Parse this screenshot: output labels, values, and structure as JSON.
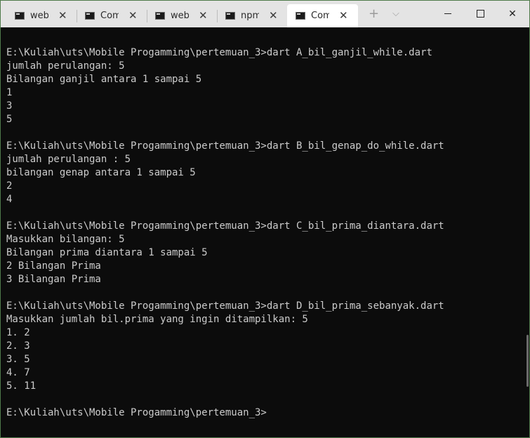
{
  "tabs": [
    {
      "label": "webp",
      "close": "✕",
      "active": false
    },
    {
      "label": "Com",
      "close": "✕",
      "active": false
    },
    {
      "label": "webp",
      "close": "✕",
      "active": false
    },
    {
      "label": "npm",
      "close": "✕",
      "active": false
    },
    {
      "label": "Com",
      "close": "✕",
      "active": true
    }
  ],
  "titlebar": {
    "new_tab_icon": "plus-icon",
    "new_tab_glyph": "+",
    "dropdown_icon": "chevron-down-icon",
    "dropdown_glyph": "⌵",
    "close_glyph": "✕"
  },
  "terminal": {
    "lines": [
      "E:\\Kuliah\\uts\\Mobile Progamming\\pertemuan_3>dart A_bil_ganjil_while.dart",
      "jumlah perulangan: 5",
      "Bilangan ganjil antara 1 sampai 5",
      "1",
      "3",
      "5",
      "",
      "E:\\Kuliah\\uts\\Mobile Progamming\\pertemuan_3>dart B_bil_genap_do_while.dart",
      "jumlah perulangan : 5",
      "bilangan genap antara 1 sampai 5",
      "2",
      "4",
      "",
      "E:\\Kuliah\\uts\\Mobile Progamming\\pertemuan_3>dart C_bil_prima_diantara.dart",
      "Masukkan bilangan: 5",
      "Bilangan prima diantara 1 sampai 5",
      "2 Bilangan Prima",
      "3 Bilangan Prima",
      "",
      "E:\\Kuliah\\uts\\Mobile Progamming\\pertemuan_3>dart D_bil_prima_sebanyak.dart",
      "Masukkan jumlah bil.prima yang ingin ditampilkan: 5",
      "1. 2",
      "2. 3",
      "3. 5",
      "4. 7",
      "5. 11",
      "",
      "E:\\Kuliah\\uts\\Mobile Progamming\\pertemuan_3>"
    ]
  },
  "colors": {
    "terminal_bg": "#0c0c0c",
    "terminal_fg": "#cccccc",
    "titlebar_bg": "#e4e4e4",
    "active_tab_bg": "#ffffff"
  }
}
